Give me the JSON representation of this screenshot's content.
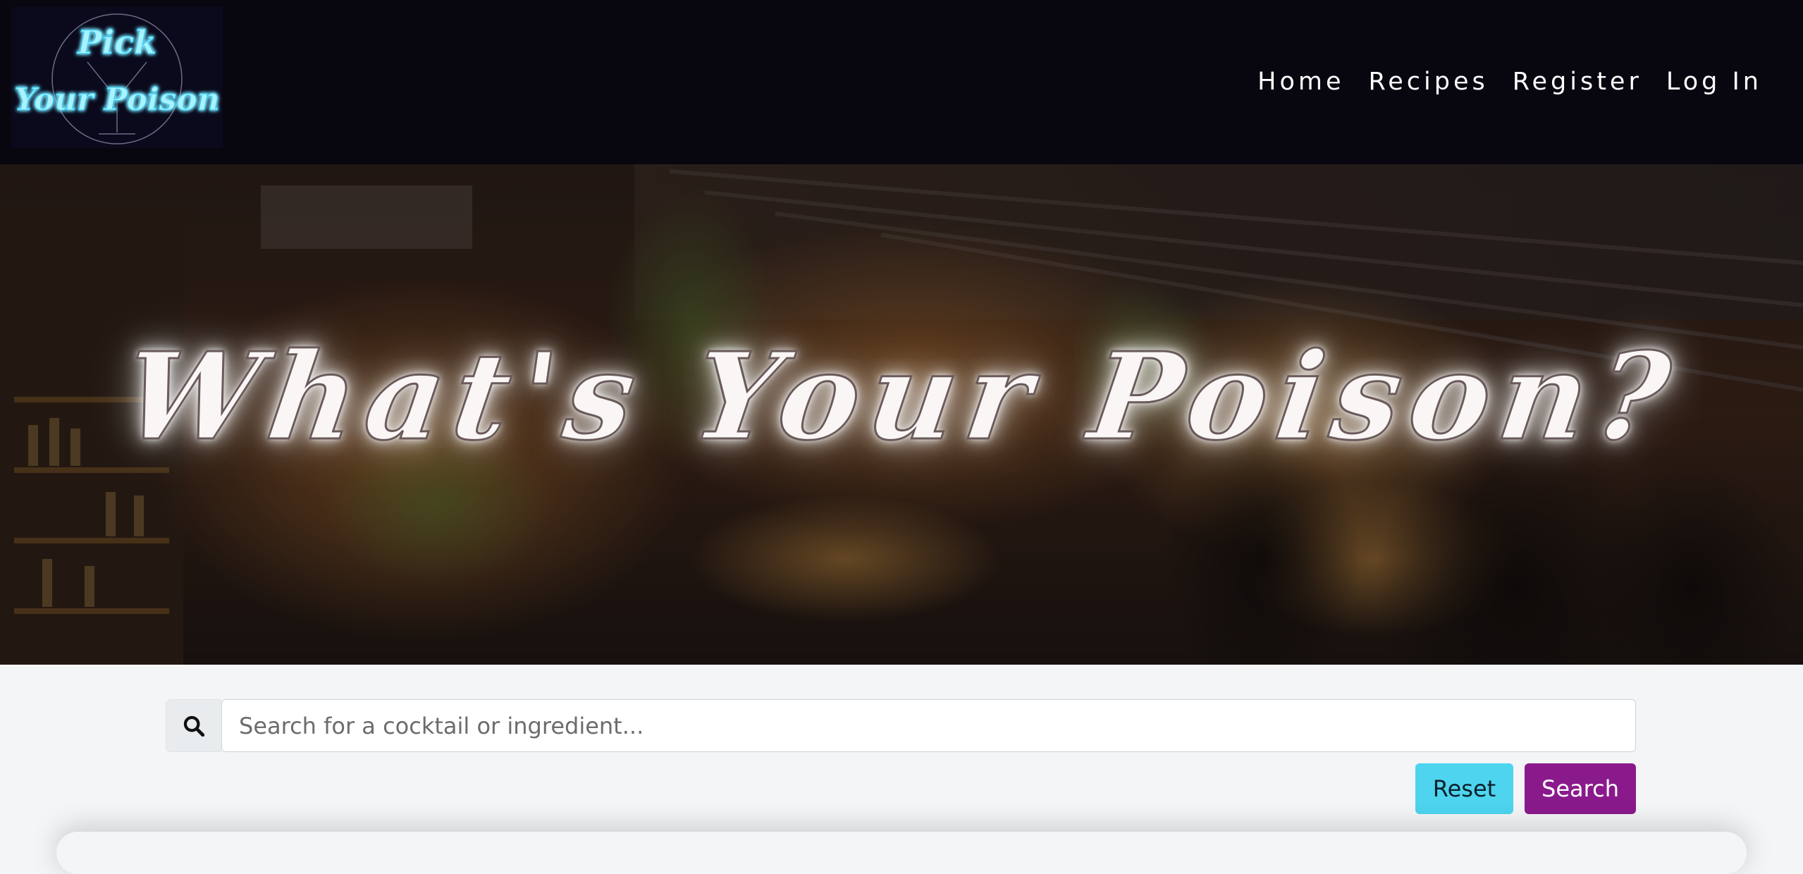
{
  "navbar": {
    "brand": {
      "line1": "Pick",
      "line2": "Your Poison"
    },
    "links": [
      {
        "label": "Home"
      },
      {
        "label": "Recipes"
      },
      {
        "label": "Register"
      },
      {
        "label": "Log In"
      }
    ]
  },
  "hero": {
    "title": "What's Your Poison?"
  },
  "search": {
    "placeholder": "Search for a cocktail or ingredient...",
    "value": "",
    "icon": "search-icon"
  },
  "buttons": {
    "reset_label": "Reset",
    "search_label": "Search"
  },
  "colors": {
    "navbar_bg": "#08060f",
    "neon_logo": "#4ee0ff",
    "reset_button": "#4ed4ef",
    "search_button": "#8a1a8c",
    "page_bg": "#f4f5f7"
  }
}
